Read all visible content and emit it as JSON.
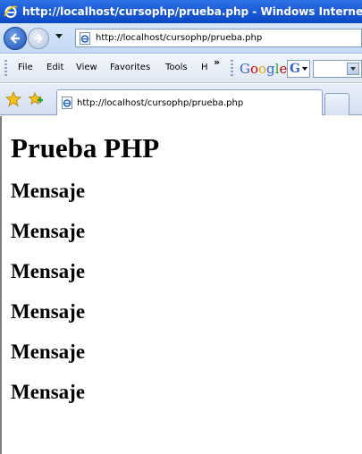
{
  "window": {
    "title": "http://localhost/cursophp/prueba.php - Windows Internet Explorer"
  },
  "navigation": {
    "address": "http://localhost/cursophp/prueba.php"
  },
  "menu": {
    "items": [
      "File",
      "Edit",
      "View",
      "Favorites",
      "Tools",
      "H"
    ],
    "overflow": "»"
  },
  "google_toolbar": {
    "logo": "Google",
    "logo_letters": [
      "G",
      "o",
      "o",
      "g",
      "l",
      "e"
    ],
    "logo_colors": [
      "#3366cc",
      "#cc0000",
      "#ffcc00",
      "#3366cc",
      "#33aa33",
      "#cc0000"
    ],
    "button_letter": "G"
  },
  "tabs": [
    {
      "label": "http://localhost/cursophp/prueba.php"
    }
  ],
  "page": {
    "heading": "Prueba PHP",
    "messages": [
      "Mensaje",
      "Mensaje",
      "Mensaje",
      "Mensaje",
      "Mensaje",
      "Mensaje"
    ]
  }
}
